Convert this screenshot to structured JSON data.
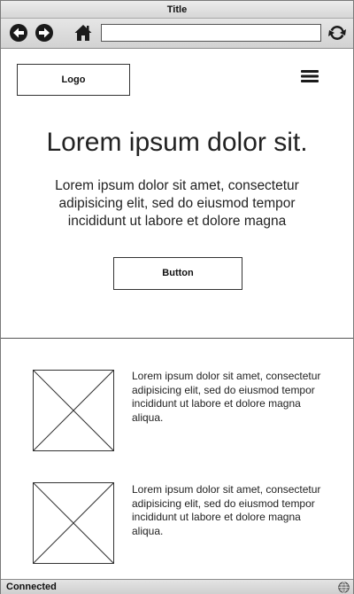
{
  "window": {
    "title": "Title"
  },
  "toolbar": {
    "back_icon": "back-arrow-icon",
    "forward_icon": "forward-arrow-icon",
    "home_icon": "home-icon",
    "reload_icon": "reload-icon",
    "url_value": ""
  },
  "header": {
    "logo_label": "Logo",
    "menu_icon": "hamburger-menu-icon"
  },
  "hero": {
    "title": "Lorem ipsum dolor sit.",
    "text": "Lorem ipsum dolor sit amet, consectetur adipisicing elit, sed do eiusmod tempor incididunt ut labore et dolore magna",
    "button_label": "Button"
  },
  "media_items": [
    {
      "image_icon": "image-placeholder-icon",
      "text": "Lorem ipsum dolor sit amet, consectetur adipisicing elit, sed do eiusmod tempor incididunt ut labore et dolore magna aliqua."
    },
    {
      "image_icon": "image-placeholder-icon",
      "text": "Lorem ipsum dolor sit amet, consectetur adipisicing elit, sed do eiusmod tempor incididunt ut labore et dolore magna aliqua."
    }
  ],
  "statusbar": {
    "status": "Connected",
    "globe_icon": "globe-icon"
  },
  "colors": {
    "chrome": "#d9d9d9",
    "border": "#333333",
    "text": "#222222"
  }
}
